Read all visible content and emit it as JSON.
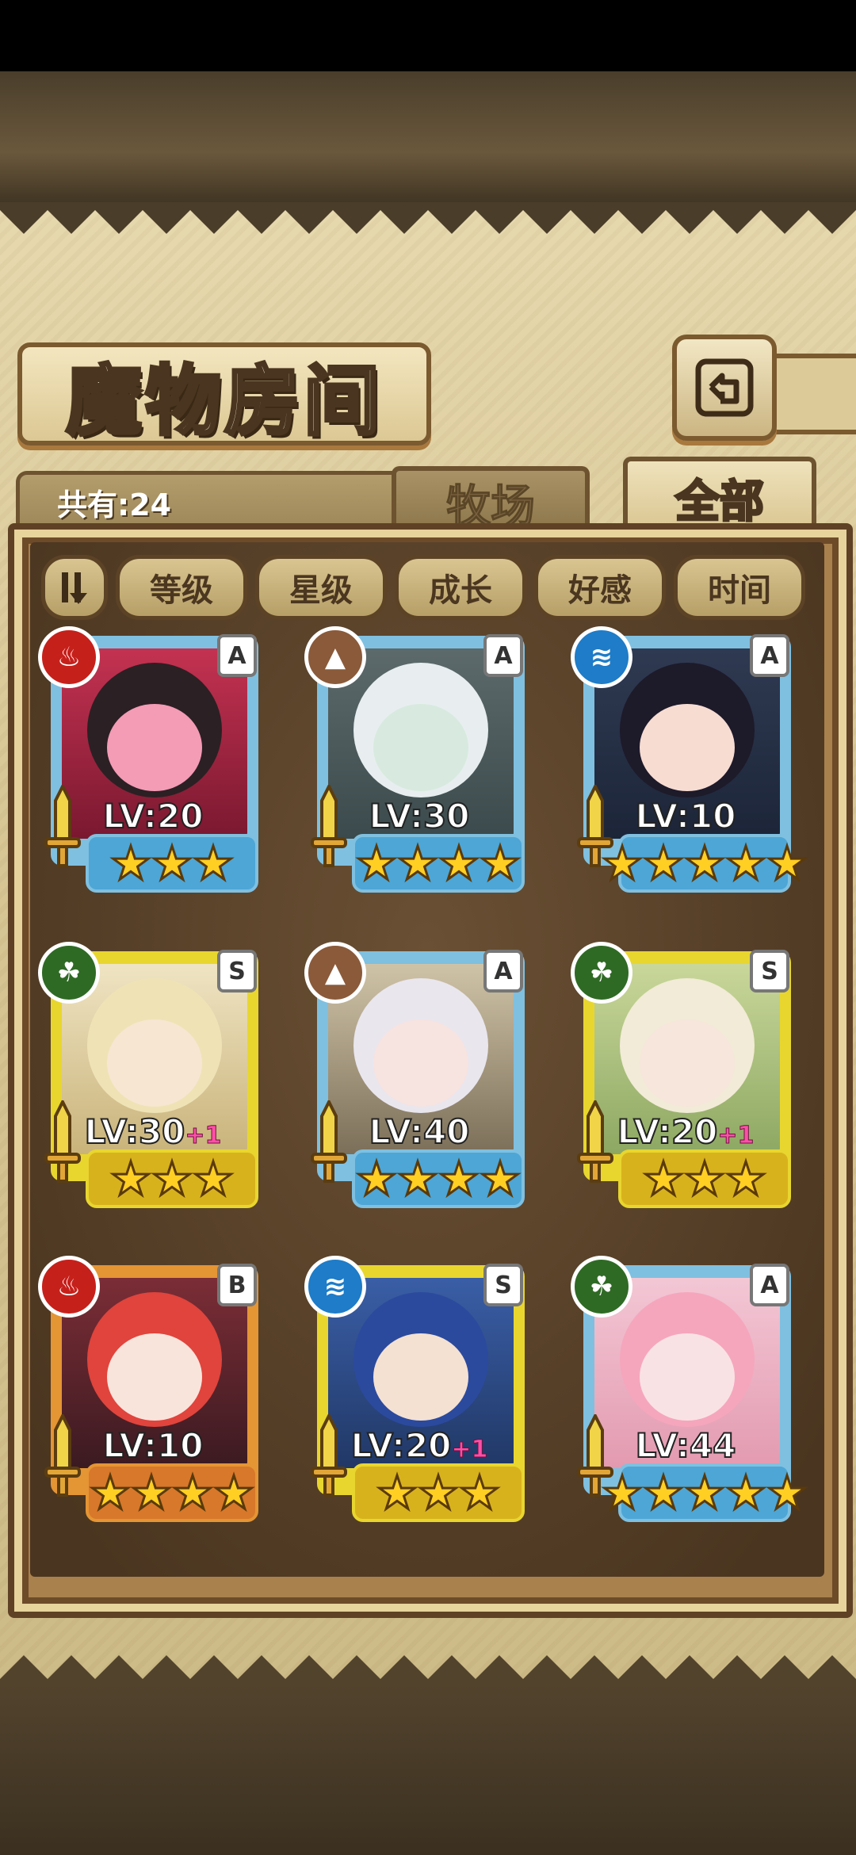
{
  "header": {
    "title": "魔物房间",
    "back_icon": "return-arrow-icon"
  },
  "summary": {
    "count_text": "共有:24"
  },
  "tabs": [
    {
      "label": "牧场",
      "active": false
    },
    {
      "label": "全部",
      "active": true
    }
  ],
  "filters": [
    {
      "label": "",
      "icon": "sort-toggle-icon"
    },
    {
      "label": "等级"
    },
    {
      "label": "星级"
    },
    {
      "label": "成长"
    },
    {
      "label": "好感"
    },
    {
      "label": "时间"
    }
  ],
  "colors": {
    "fire": "#c6201b",
    "earth": "#8a5a3a",
    "water": "#1e7cc8",
    "nature": "#2f6a25",
    "frame_blue": "#7fc0e0",
    "frame_gold": "#e8d62f",
    "frame_orange": "#e49534"
  },
  "monsters": [
    {
      "element": "fire",
      "rank": "A",
      "level": "LV:20",
      "bonus": "",
      "stars": 3,
      "frame": "blue"
    },
    {
      "element": "earth",
      "rank": "A",
      "level": "LV:30",
      "bonus": "",
      "stars": 4,
      "frame": "blue"
    },
    {
      "element": "water",
      "rank": "A",
      "level": "LV:10",
      "bonus": "",
      "stars": 5,
      "frame": "blue"
    },
    {
      "element": "nature",
      "rank": "S",
      "level": "LV:30",
      "bonus": "+1",
      "stars": 3,
      "frame": "gold"
    },
    {
      "element": "earth",
      "rank": "A",
      "level": "LV:40",
      "bonus": "",
      "stars": 4,
      "frame": "blue"
    },
    {
      "element": "nature",
      "rank": "S",
      "level": "LV:20",
      "bonus": "+1",
      "stars": 3,
      "frame": "gold"
    },
    {
      "element": "fire",
      "rank": "B",
      "level": "LV:10",
      "bonus": "",
      "stars": 4,
      "frame": "orange"
    },
    {
      "element": "water",
      "rank": "S",
      "level": "LV:20",
      "bonus": "+1",
      "stars": 3,
      "frame": "gold"
    },
    {
      "element": "nature",
      "rank": "A",
      "level": "LV:44",
      "bonus": "",
      "stars": 5,
      "frame": "blue"
    }
  ]
}
